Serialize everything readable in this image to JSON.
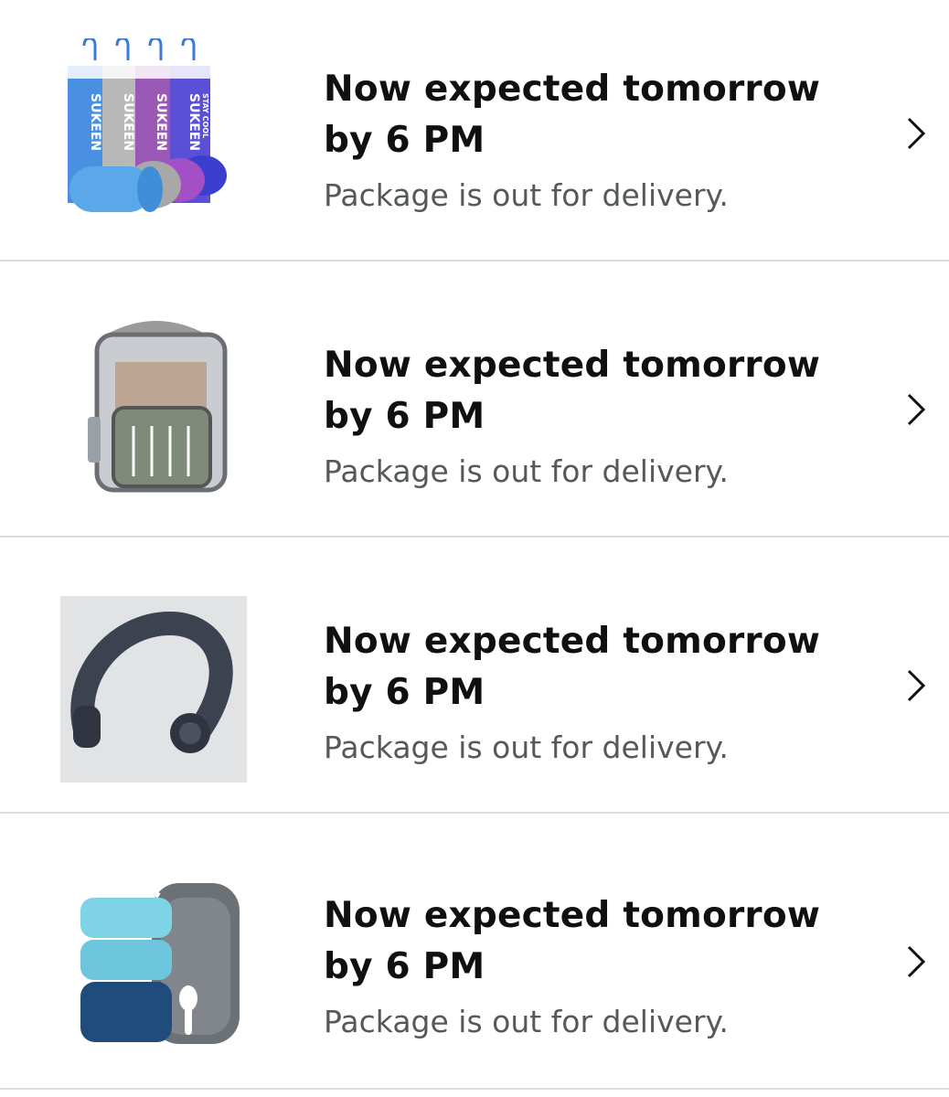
{
  "deliveries": [
    {
      "product_icon": "cooling-towel-pack-image",
      "brand_text": "SUKEEN",
      "tag_text": "STAY COOL",
      "title": "Now expected tomorrow by 6 PM",
      "status": "Package is out for delivery."
    },
    {
      "product_icon": "clear-backpack-image",
      "title": "Now expected tomorrow by 6 PM",
      "status": "Package is out for delivery."
    },
    {
      "product_icon": "neck-fan-image",
      "title": "Now expected tomorrow by 6 PM",
      "status": "Package is out for delivery."
    },
    {
      "product_icon": "lunch-box-set-image",
      "title": "Now expected tomorrow by 6 PM",
      "status": "Package is out for delivery."
    }
  ],
  "icons": {
    "chevron": "chevron-right-icon"
  },
  "colors": {
    "title": "#0f1111",
    "status": "#565959",
    "divider": "#dddddd"
  }
}
